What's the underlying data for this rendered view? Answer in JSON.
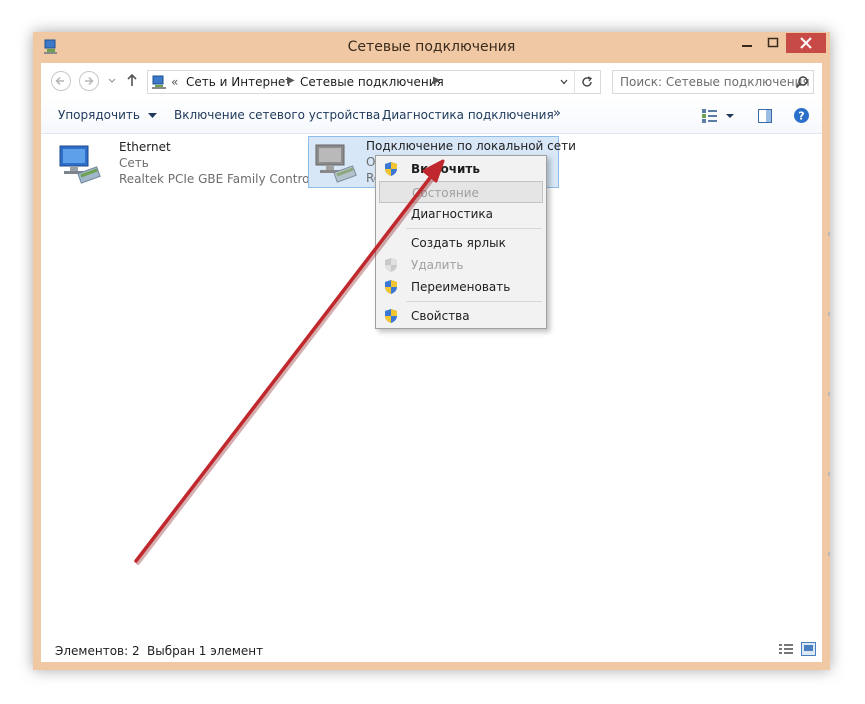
{
  "window": {
    "title": "Сетевые подключения"
  },
  "address": {
    "overflow": "«",
    "crumbs": [
      "Сеть и Интернет",
      "Сетевые подключения"
    ],
    "search_placeholder": "Поиск: Сетевые подключения"
  },
  "toolbar": {
    "organize": "Упорядочить",
    "enable_device": "Включение сетевого устройства",
    "diagnose": "Диагностика подключения",
    "more": "»"
  },
  "connections": [
    {
      "name": "Ethernet",
      "network": "Сеть",
      "adapter": "Realtek PCIe GBE Family Controller"
    },
    {
      "name": "Подключение по локальной сети",
      "network_partial": "О",
      "adapter_partial": "Re"
    }
  ],
  "context_menu": {
    "items": [
      {
        "label": "Включить",
        "bold": true,
        "disabled": false,
        "icon": "shield-icon"
      },
      {
        "label": "Состояние",
        "bold": false,
        "disabled": true,
        "icon": ""
      },
      {
        "label": "Диагностика",
        "bold": false,
        "disabled": false,
        "icon": ""
      },
      {
        "label": "Создать ярлык",
        "bold": false,
        "disabled": false,
        "icon": ""
      },
      {
        "label": "Удалить",
        "bold": false,
        "disabled": true,
        "icon": "shield-icon"
      },
      {
        "label": "Переименовать",
        "bold": false,
        "disabled": false,
        "icon": "shield-icon"
      },
      {
        "label": "Свойства",
        "bold": false,
        "disabled": false,
        "icon": "shield-icon"
      }
    ]
  },
  "status": {
    "count": "Элементов: 2",
    "selection": "Выбран 1 элемент"
  },
  "colors": {
    "titlebar": "#f0c8a4",
    "close": "#c74a47",
    "arrow": "#c0282d",
    "selection": "#d8e7f7"
  }
}
